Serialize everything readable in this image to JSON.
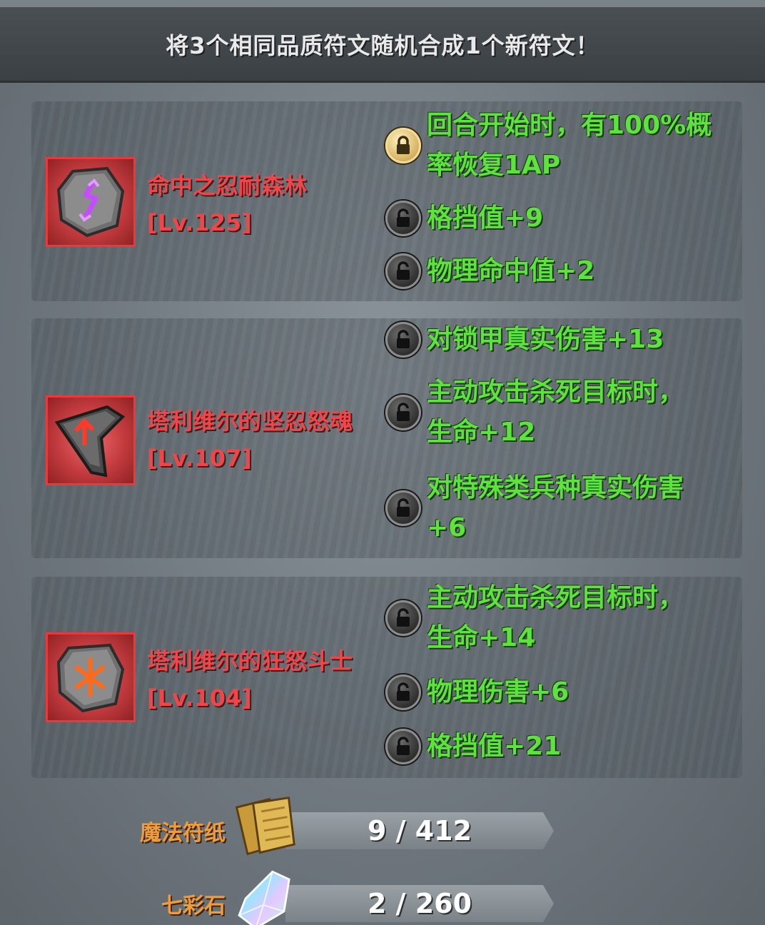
{
  "header": {
    "title": "将3个相同品质符文随机合成1个新符文！"
  },
  "runes": [
    {
      "name": "命中之忍耐森林",
      "level": "[Lv.125]",
      "icon": "purple-rune-stone-icon",
      "attributes": [
        {
          "text": "回合开始时，有100%概率恢复1AP",
          "lock": "gold-lock-icon"
        },
        {
          "text": "格挡值+9",
          "lock": "open-lock-icon"
        },
        {
          "text": "物理命中值+2",
          "lock": "open-lock-icon"
        }
      ]
    },
    {
      "name": "塔利维尔的坚忍怒魂",
      "level": "[Lv.107]",
      "icon": "red-arrow-shard-icon",
      "attributes": [
        {
          "text": "对锁甲真实伤害+13",
          "lock": "open-lock-icon"
        },
        {
          "text": "主动攻击杀死目标时，生命+12",
          "lock": "open-lock-icon"
        },
        {
          "text": "对特殊类兵种真实伤害+6",
          "lock": "open-lock-icon"
        }
      ]
    },
    {
      "name": "塔利维尔的狂怒斗士",
      "level": "[Lv.104]",
      "icon": "orange-rune-stone-icon",
      "attributes": [
        {
          "text": "主动攻击杀死目标时，生命+14",
          "lock": "open-lock-icon"
        },
        {
          "text": "物理伤害+6",
          "lock": "open-lock-icon"
        },
        {
          "text": "格挡值+21",
          "lock": "open-lock-icon"
        }
      ]
    }
  ],
  "resources": [
    {
      "label": "魔法符纸",
      "value": "9 / 412",
      "icon": "magic-paper-icon"
    },
    {
      "label": "七彩石",
      "value": "2 / 260",
      "icon": "rainbow-stone-icon"
    }
  ],
  "colors": {
    "rune_name": "#f0464a",
    "attribute": "#5ee33e",
    "resource_label": "#f29b3b",
    "rune_frame": "#e8393c"
  }
}
